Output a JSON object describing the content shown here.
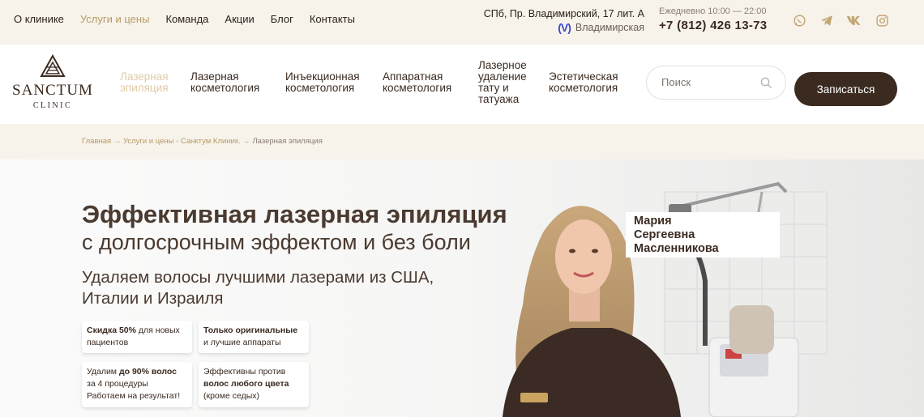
{
  "topbar": {
    "nav": [
      "О клинике",
      "Услуги и цены",
      "Команда",
      "Акции",
      "Блог",
      "Контакты"
    ],
    "active_index": 1,
    "address": "СПб, Пр. Владимирский, 17 лит. А",
    "metro": "Владимирская",
    "hours": "Ежедневно 10:00 — 22:00",
    "phone": "+7 (812) 426 13-73",
    "socials": [
      "whatsapp-icon",
      "telegram-icon",
      "vk-icon",
      "instagram-icon"
    ]
  },
  "header": {
    "brand": "SANCTUM",
    "brand_sub": "CLINIC",
    "menu": [
      {
        "label": "Лазерная эпиляция",
        "active": true
      },
      {
        "label": "Лазерная косметология"
      },
      {
        "label": "Инъекционная косметология"
      },
      {
        "label": "Аппаратная косметология"
      },
      {
        "label": "Лазерное удаление тату и татуажа"
      },
      {
        "label": "Эстетическая косметология"
      }
    ],
    "search_placeholder": "Поиск",
    "cta": "Записаться"
  },
  "breadcrumbs": {
    "home": "Главная",
    "section": "Услуги и цены - Санктум Клиник.",
    "current": "Лазерная эпиляция",
    "sep": "→"
  },
  "hero": {
    "title": "Эффективная лазерная эпиляция",
    "subtitle": "с долгосрочным эффектом и без боли",
    "lead_line1": "Удаляем волосы лучшими лазерами из США,",
    "lead_line2": "Италии и Израиля",
    "cards": [
      {
        "bold": "Скидка 50%",
        "rest": " для новых пациентов"
      },
      {
        "bold": "Только оригинальные",
        "rest": "и лучшие аппараты"
      },
      {
        "pre": "Удалим ",
        "bold": "до 90% волос",
        "rest": "за 4 процедуры Работаем на результат!"
      },
      {
        "pre": "Эффективны против ",
        "bold": "волос любого цвета",
        "rest": "(кроме седых)"
      }
    ],
    "doctor_name": [
      "Мария",
      "Сергеевна",
      "Масленникова"
    ]
  },
  "colors": {
    "brand_dark": "#3a2a20",
    "accent_gold": "#b89a66",
    "bar_bg": "#f7f3ea"
  }
}
